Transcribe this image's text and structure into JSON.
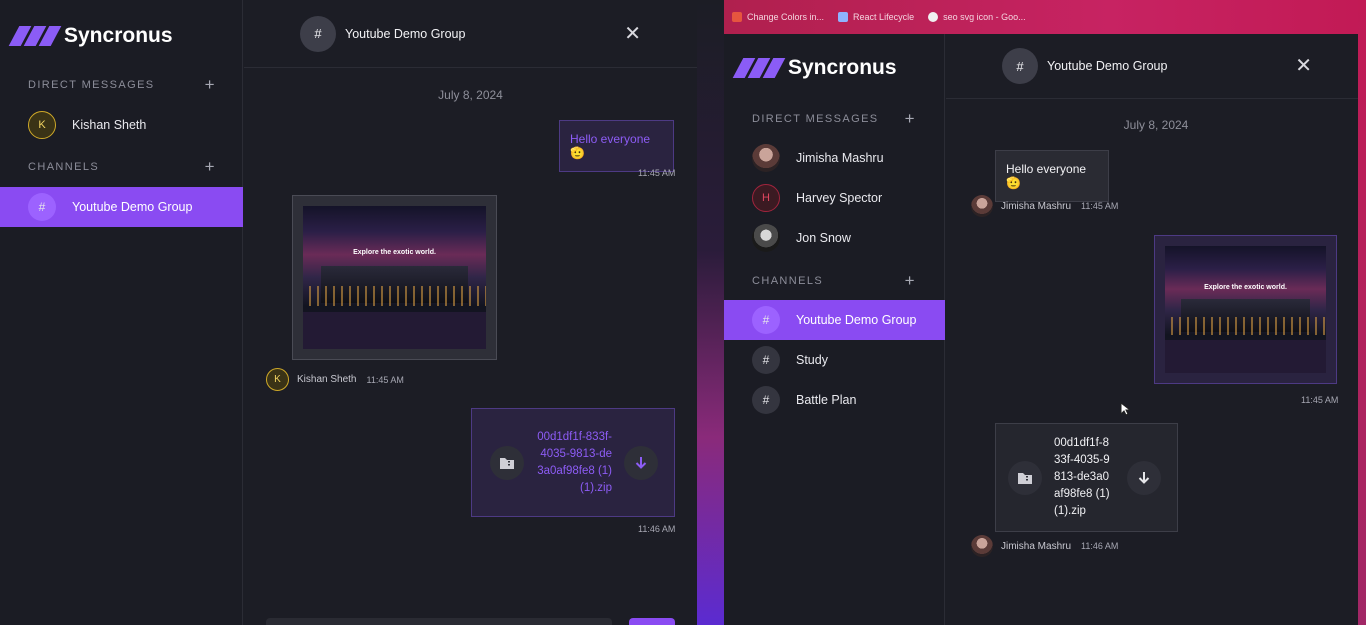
{
  "app": {
    "name": "Syncronus"
  },
  "colors": {
    "accent": "#8a4bf2",
    "background": "#1c1d25",
    "own_bubble_text": "#8d5cf5"
  },
  "sidebar": {
    "dm_header": "DIRECT MESSAGES",
    "channels_header": "CHANNELS",
    "add_icon": "plus-icon"
  },
  "left": {
    "contacts": [
      {
        "initial": "K",
        "name": "Kishan Sheth"
      }
    ],
    "channels": [
      {
        "name": "Youtube Demo Group",
        "active": true
      }
    ],
    "chat": {
      "title": "Youtube Demo Group",
      "date": "July 8, 2024",
      "messages": [
        {
          "type": "text",
          "own": true,
          "text": "Hello everyone🫡",
          "time": "11:45 AM"
        },
        {
          "type": "image",
          "own": false,
          "sender_initial": "K",
          "sender": "Kishan Sheth",
          "time": "11:45 AM",
          "image_caption": "Explore the exotic world."
        },
        {
          "type": "file",
          "own": true,
          "file_name": "00d1df1f-833f-4035-9813-de3a0af98fe8 (1) (1).zip",
          "time": "11:46 AM"
        }
      ]
    }
  },
  "browser": {
    "bookmarks": [
      {
        "label": "Change Colors in...",
        "color": "#e6553f"
      },
      {
        "label": "React Lifecycle",
        "color": "#8fb3ff"
      },
      {
        "label": "seo svg icon - Goo...",
        "color": "#f0f0f0"
      }
    ]
  },
  "right": {
    "contacts": [
      {
        "name": "Jimisha Mashru",
        "avatar": "photo"
      },
      {
        "name": "Harvey Spector",
        "avatar": "initial",
        "initial": "H"
      },
      {
        "name": "Jon Snow",
        "avatar": "photo"
      }
    ],
    "channels": [
      {
        "name": "Youtube Demo Group",
        "active": true
      },
      {
        "name": "Study",
        "active": false
      },
      {
        "name": "Battle Plan",
        "active": false
      }
    ],
    "chat": {
      "title": "Youtube Demo Group",
      "date": "July 8, 2024",
      "messages": [
        {
          "type": "text",
          "own": false,
          "text": "Hello everyone🫡",
          "sender": "Jimisha Mashru",
          "time": "11:45 AM"
        },
        {
          "type": "image",
          "own": true,
          "time": "11:45 AM",
          "image_caption": "Explore the exotic world."
        },
        {
          "type": "file",
          "own": false,
          "file_name": "00d1df1f-833f-4035-9813-de3a0af98fe8 (1) (1).zip",
          "sender": "Jimisha Mashru",
          "time": "11:46 AM"
        }
      ]
    }
  }
}
